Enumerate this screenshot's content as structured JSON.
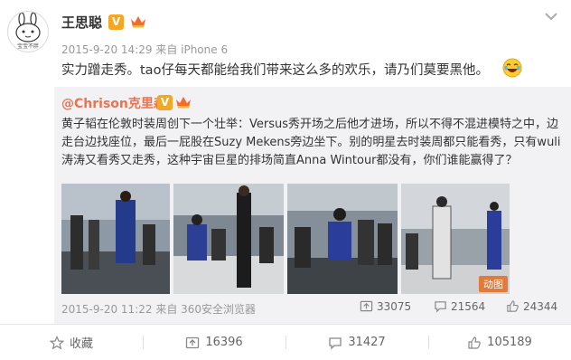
{
  "post": {
    "username": "王思聪",
    "verified_badge": "V",
    "avatar_caption": "宝宝不胖",
    "meta": "2015-9-20 14:29 来自 iPhone 6",
    "text": "实力蹭走秀。tao仔每天都能给我们带来这么多的欢乐，请乃们莫要黑他。"
  },
  "repost": {
    "username": "@Chrison克里森",
    "verified_badge": "V",
    "text": "黄子韬在伦敦时装周创下一个壮举：Versus秀开场之后他才进场，所以不得不混进模特之中，边走台边找座位，最后一屁股在Suzy Mekens旁边坐下。别的明星去时装周都只能看秀，只有wuli涛涛又看秀又走秀，这种宇宙巨星的排场简直Anna Wintour都没有，你们谁能赢得了？",
    "gif_badge": "动图",
    "meta": "2015-9-20 11:22 来自 360安全浏览器",
    "reposts": "33075",
    "comments": "21564",
    "likes": "24344"
  },
  "actions": {
    "favorite": "收藏",
    "reposts": "16396",
    "comments": "31427",
    "likes": "105189"
  },
  "colors": {
    "badge": "#f5a623",
    "repost_user": "#eb7350",
    "repost_bg": "#f2f2f5"
  }
}
